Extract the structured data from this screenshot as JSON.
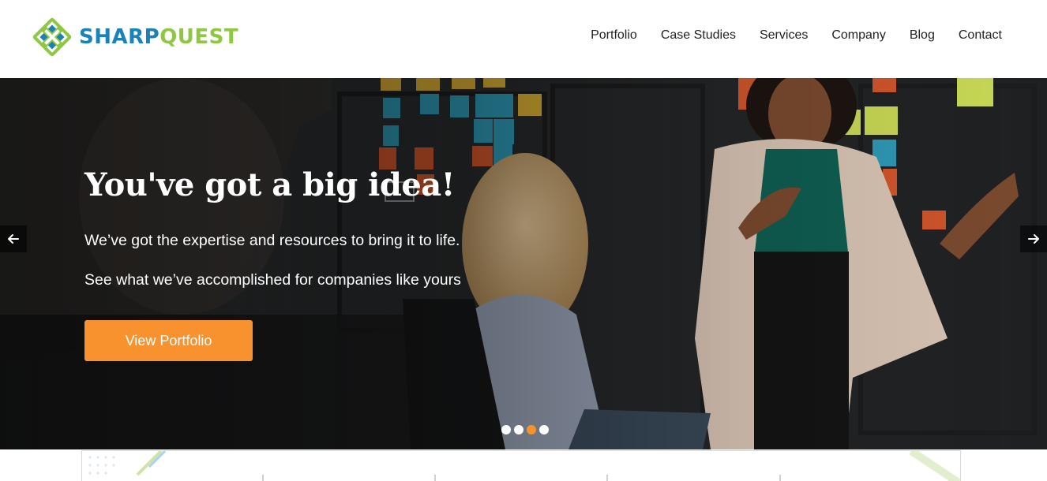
{
  "brand": {
    "name_part1": "SHARP",
    "name_part2": "QUEST",
    "color_primary": "#1a82b8",
    "color_secondary": "#8fc742",
    "logo_icon": "sharpquest-logo-mark"
  },
  "nav": {
    "items": [
      {
        "label": "Portfolio"
      },
      {
        "label": "Case Studies"
      },
      {
        "label": "Services"
      },
      {
        "label": "Company"
      },
      {
        "label": "Blog"
      },
      {
        "label": "Contact"
      }
    ]
  },
  "hero": {
    "title": "You've got a big idea!",
    "line1": "We’ve got the expertise and resources to bring it to life.",
    "line2": "See what we’ve accomplished for companies like yours",
    "cta_label": "View Portfolio",
    "cta_color": "#f7922e",
    "prev_icon": "arrow-left-icon",
    "next_icon": "arrow-right-icon",
    "slides_total": 4,
    "active_slide": 3
  }
}
